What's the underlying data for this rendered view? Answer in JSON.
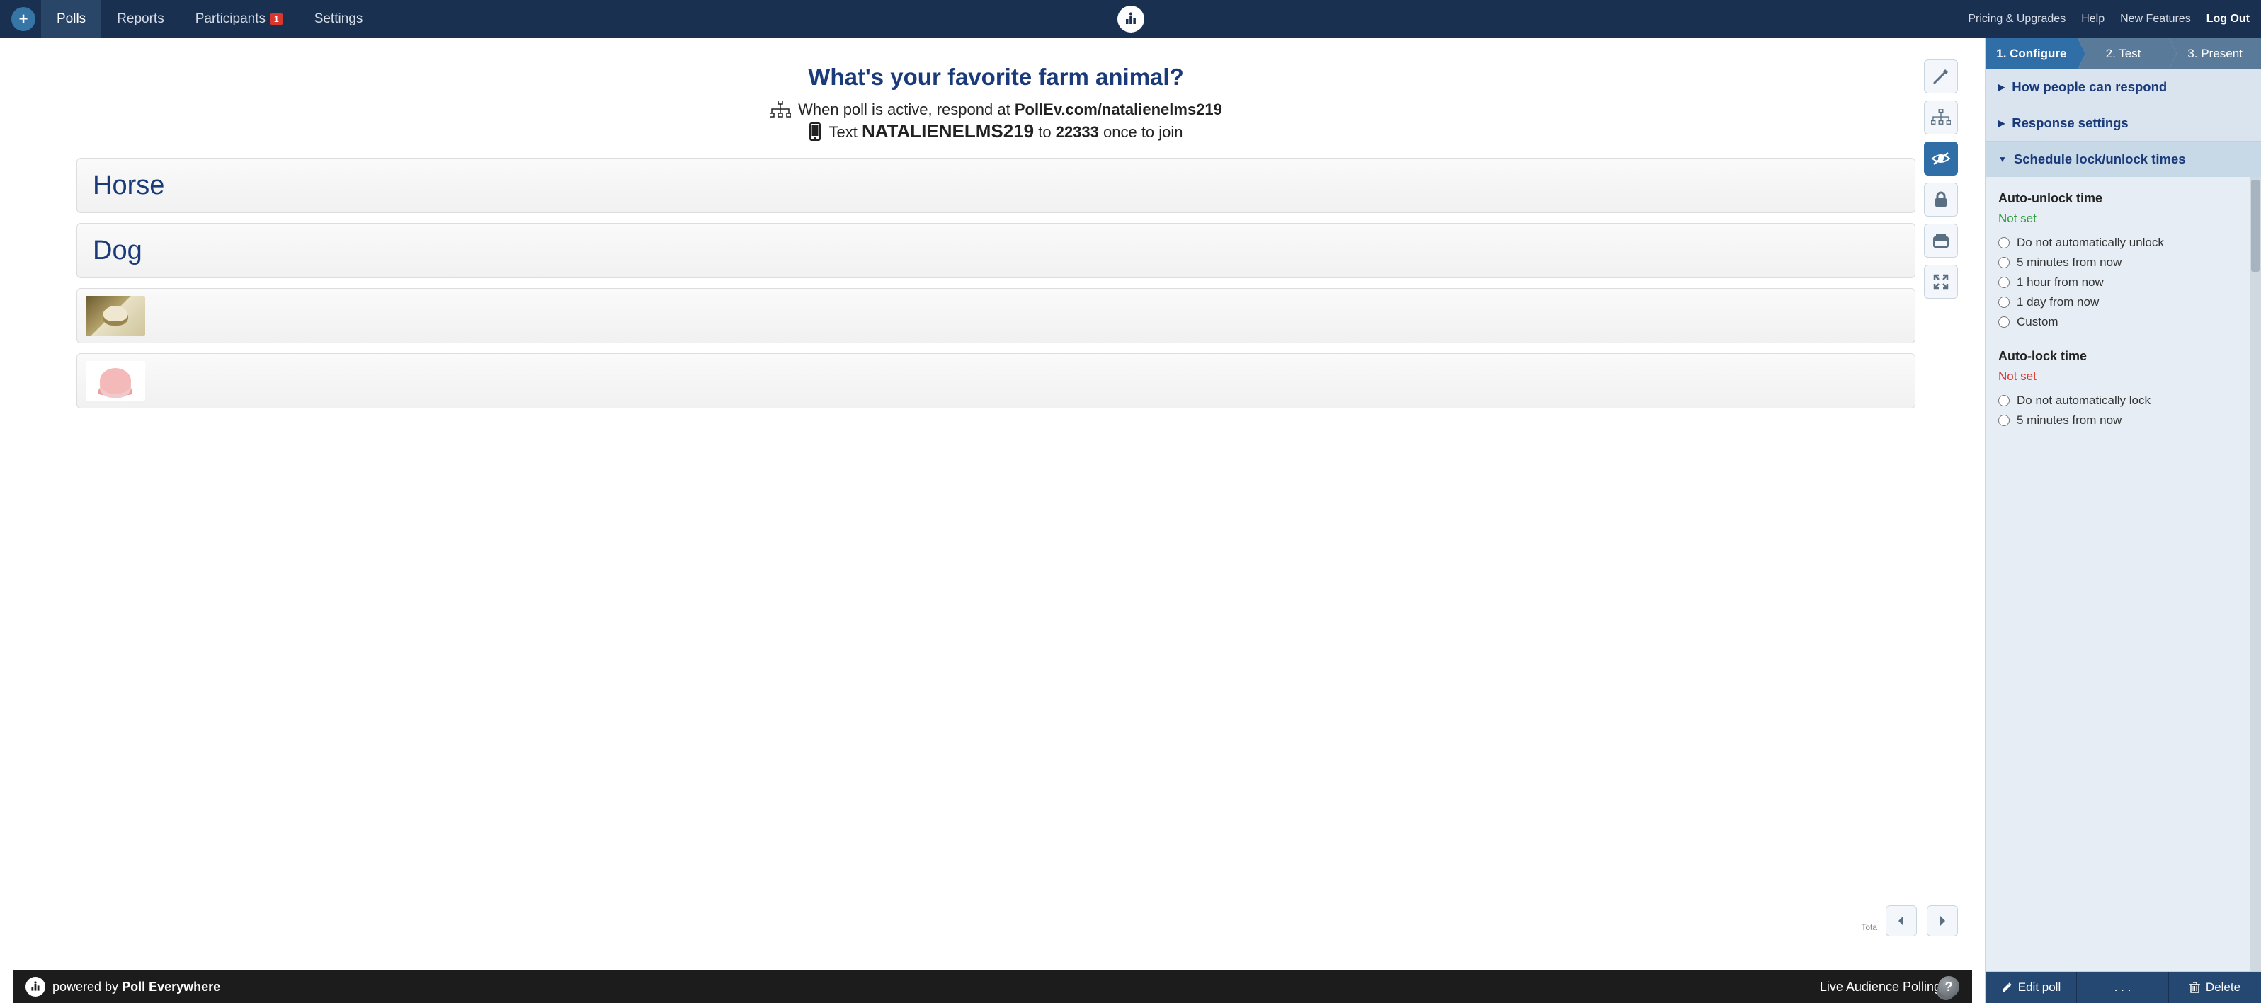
{
  "nav": {
    "items": [
      {
        "label": "Polls",
        "active": true,
        "badge": null
      },
      {
        "label": "Reports",
        "active": false,
        "badge": null
      },
      {
        "label": "Participants",
        "active": false,
        "badge": "1"
      },
      {
        "label": "Settings",
        "active": false,
        "badge": null
      }
    ],
    "right": [
      {
        "label": "Pricing & Upgrades",
        "bold": false
      },
      {
        "label": "Help",
        "bold": false
      },
      {
        "label": "New Features",
        "bold": false
      },
      {
        "label": "Log Out",
        "bold": true
      }
    ]
  },
  "poll": {
    "title": "What's your favorite farm animal?",
    "instruction1_prefix": "When poll is active, respond at ",
    "instruction1_bold": "PollEv.com/natalienelms219",
    "instruction2_prefix": "Text ",
    "instruction2_code": "NATALIENELMS219",
    "instruction2_mid": " to ",
    "instruction2_num": "22333",
    "instruction2_suffix": " once to join",
    "options": [
      "Horse",
      "Dog"
    ],
    "image_options": [
      "sheep",
      "pig"
    ],
    "total_label": "Tota"
  },
  "footer": {
    "powered_prefix": "powered by ",
    "powered_brand": "Poll Everywhere",
    "right_text": "Live Audience Polling"
  },
  "sidebar": {
    "steps": [
      "1. Configure",
      "2. Test",
      "3. Present"
    ],
    "active_step": 0,
    "sections": [
      {
        "title": "How people can respond",
        "expanded": false
      },
      {
        "title": "Response settings",
        "expanded": false
      },
      {
        "title": "Schedule lock/unlock times",
        "expanded": true
      }
    ],
    "schedule": {
      "unlock_title": "Auto-unlock time",
      "unlock_status": "Not set",
      "unlock_options": [
        "Do not automatically unlock",
        "5 minutes from now",
        "1 hour from now",
        "1 day from now",
        "Custom"
      ],
      "lock_title": "Auto-lock time",
      "lock_status": "Not set",
      "lock_options": [
        "Do not automatically lock",
        "5 minutes from now"
      ]
    },
    "actions": {
      "edit": "Edit poll",
      "more": ". . .",
      "delete": "Delete"
    }
  }
}
